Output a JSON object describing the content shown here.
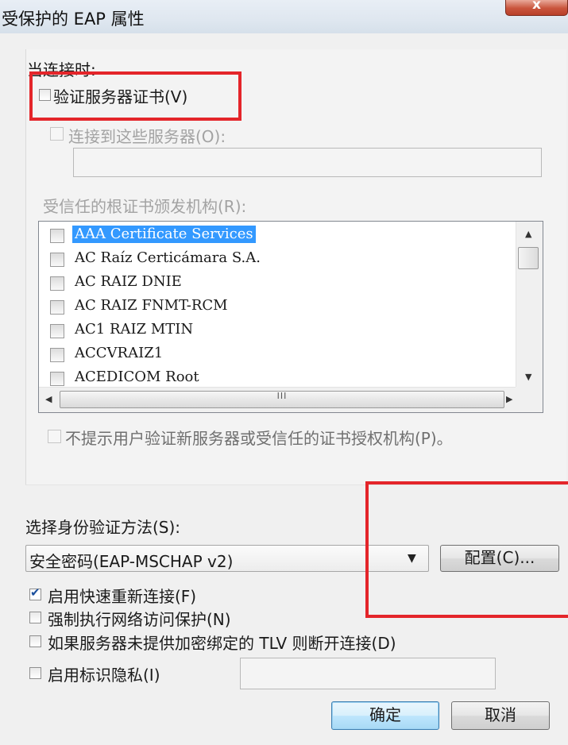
{
  "window": {
    "title": "受保护的 EAP 属性",
    "close_glyph": "x"
  },
  "connect_section": {
    "heading": "当连接时:",
    "verify_server_cert": {
      "label": "验证服务器证书(V)",
      "checked": false
    },
    "connect_to_servers": {
      "label": "连接到这些服务器(O):",
      "checked": false,
      "enabled": false,
      "value": ""
    },
    "trusted_ca_label": "受信任的根证书颁发机构(R):",
    "certificates": [
      {
        "name": "AAA Certificate Services",
        "checked": false,
        "selected": true
      },
      {
        "name": "AC Raíz Certicámara S.A.",
        "checked": false,
        "selected": false
      },
      {
        "name": "AC RAIZ DNIE",
        "checked": false,
        "selected": false
      },
      {
        "name": "AC RAIZ FNMT-RCM",
        "checked": false,
        "selected": false
      },
      {
        "name": "AC1 RAIZ MTIN",
        "checked": false,
        "selected": false
      },
      {
        "name": "ACCVRAIZ1",
        "checked": false,
        "selected": false
      },
      {
        "name": "ACEDICOM Root",
        "checked": false,
        "selected": false
      }
    ],
    "hscroll_grip": "III",
    "no_prompt": {
      "label": "不提示用户验证新服务器或受信任的证书授权机构(P)。",
      "checked": false,
      "enabled": false
    }
  },
  "auth_method": {
    "label": "选择身份验证方法(S):",
    "selected": "安全密码(EAP-MSCHAP v2)",
    "configure_label": "配置(C)..."
  },
  "options": [
    {
      "label": "启用快速重新连接(F)",
      "checked": true
    },
    {
      "label": "强制执行网络访问保护(N)",
      "checked": false
    },
    {
      "label": "如果服务器未提供加密绑定的 TLV 则断开连接(D)",
      "checked": false
    },
    {
      "label": "启用标识隐私(I)",
      "checked": false,
      "value": ""
    }
  ],
  "buttons": {
    "ok_label": "确定",
    "cancel_label": "取消"
  },
  "annotation_color": "#e4252a"
}
